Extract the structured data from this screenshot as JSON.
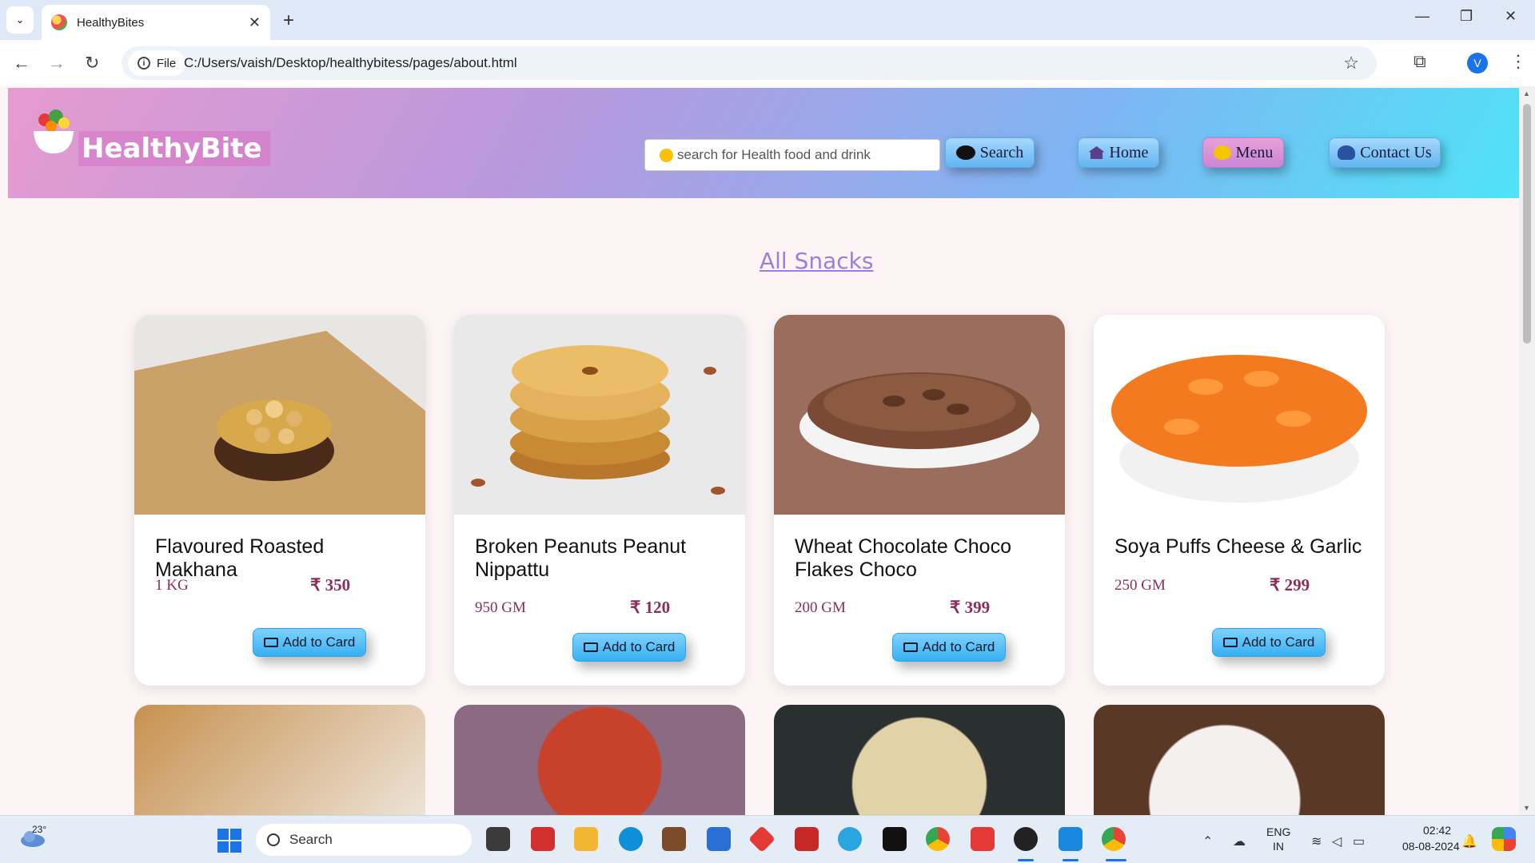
{
  "browser": {
    "tab_title": "HealthyBites",
    "url_chip": "File",
    "url": "C:/Users/vaish/Desktop/healthybitess/pages/about.html",
    "profile_initial": "V"
  },
  "header": {
    "logo_text": "HealthyBite",
    "search_placeholder": "search for Health food and drink",
    "search_button": "Search",
    "nav": {
      "home": "Home",
      "menu": "Menu",
      "contact": "Contact Us"
    }
  },
  "section_title": "All Snacks",
  "products": [
    {
      "name": "Flavoured Roasted Makhana",
      "weight": "1 KG",
      "price": "₹ 350",
      "button": "Add to Card"
    },
    {
      "name": "Broken Peanuts Peanut Nippattu",
      "weight": "950 GM",
      "price": "₹ 120",
      "button": "Add to Card"
    },
    {
      "name": "Wheat Chocolate Choco Flakes Choco",
      "weight": "200 GM",
      "price": "₹ 399",
      "button": "Add to Card"
    },
    {
      "name": "Soya Puffs Cheese & Garlic",
      "weight": "250 GM",
      "price": "₹ 299",
      "button": "Add to Card"
    }
  ],
  "taskbar": {
    "weather_temp": "23°",
    "search_label": "Search",
    "lang_line1": "ENG",
    "lang_line2": "IN",
    "time": "02:42",
    "date": "08-08-2024"
  },
  "colors": {
    "accent_button": "#38b0f2",
    "price": "#8a2e5a",
    "section_title": "#9b7fd8"
  }
}
